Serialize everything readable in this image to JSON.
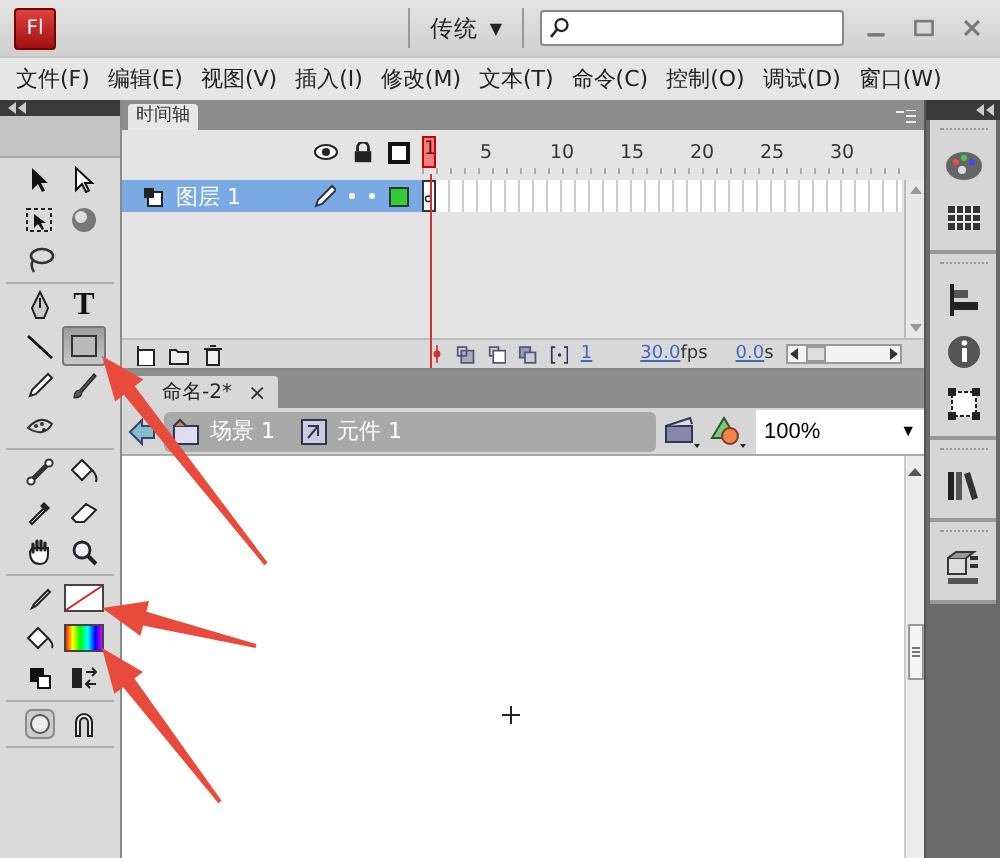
{
  "title_bar": {
    "logo": "Fl",
    "workspace": "传统",
    "workspace_caret": "▼"
  },
  "menu": [
    "文件(F)",
    "编辑(E)",
    "视图(V)",
    "插入(I)",
    "修改(M)",
    "文本(T)",
    "命令(C)",
    "控制(O)",
    "调试(D)",
    "窗口(W)"
  ],
  "tool_groups": [
    {
      "tools": [
        {
          "kind": "selection",
          "selected": false,
          "arrow_pointer": false
        },
        {
          "kind": "subselection",
          "selected": false,
          "arrow_pointer": false
        },
        {
          "kind": "transform",
          "selected": false,
          "arrow_pointer": false
        },
        {
          "kind": "rotation",
          "selected": false,
          "arrow_pointer": false
        },
        {
          "kind": "lasso",
          "selected": false,
          "arrow_pointer": false
        }
      ]
    },
    {
      "tools": [
        {
          "kind": "pen",
          "selected": false,
          "arrow_pointer": false
        },
        {
          "kind": "text",
          "label": "T",
          "selected": false,
          "arrow_pointer": false
        },
        {
          "kind": "line",
          "selected": false,
          "arrow_pointer": false
        },
        {
          "kind": "rectangle",
          "selected": true,
          "arrow_pointer": true
        },
        {
          "kind": "pencil",
          "selected": false,
          "arrow_pointer": false
        },
        {
          "kind": "brush",
          "selected": false,
          "arrow_pointer": false
        },
        {
          "kind": "deco",
          "selected": false,
          "arrow_pointer": false
        }
      ]
    },
    {
      "tools": [
        {
          "kind": "bone",
          "selected": false,
          "arrow_pointer": false
        },
        {
          "kind": "bucket",
          "selected": false,
          "arrow_pointer": false
        },
        {
          "kind": "eyedropper",
          "selected": false,
          "arrow_pointer": false
        },
        {
          "kind": "eraser",
          "selected": false,
          "arrow_pointer": false
        },
        {
          "kind": "hand",
          "selected": false,
          "arrow_pointer": false
        },
        {
          "kind": "zoom",
          "selected": false,
          "arrow_pointer": false
        }
      ]
    },
    {
      "tools": [
        {
          "kind": "strokepencil",
          "selected": false,
          "arrow_pointer": false
        },
        {
          "kind": "strokeswatch",
          "selected": false,
          "arrow_pointer": true
        },
        {
          "kind": "fillbucket",
          "selected": false,
          "arrow_pointer": false
        },
        {
          "kind": "fillswatch",
          "selected": false,
          "arrow_pointer": true
        },
        {
          "kind": "defaults",
          "selected": false,
          "arrow_pointer": false
        },
        {
          "kind": "swap",
          "selected": false,
          "arrow_pointer": false
        }
      ]
    },
    {
      "tools": [
        {
          "kind": "objectdrawing",
          "selected": false,
          "arrow_pointer": false
        },
        {
          "kind": "snap",
          "selected": false,
          "arrow_pointer": false
        }
      ]
    }
  ],
  "timeline": {
    "tab": "时间轴",
    "frame_numbers": [
      "1",
      "5",
      "10",
      "15",
      "20",
      "25",
      "30"
    ],
    "layers": [
      {
        "name": "图层 1",
        "selected": true,
        "color": "#33cc33"
      }
    ],
    "current_frame": "1",
    "frame_rate": "30.0",
    "frame_rate_unit": "fps",
    "elapsed_time": "0.0",
    "elapsed_time_unit": "s"
  },
  "document": {
    "tab": "命名-2*",
    "tab_close": "×",
    "breadcrumbs": [
      {
        "kind": "scene",
        "label": "场景 1"
      },
      {
        "kind": "symbol",
        "label": "元件 1"
      }
    ],
    "zoom": "100%",
    "zoom_caret": "▼"
  }
}
